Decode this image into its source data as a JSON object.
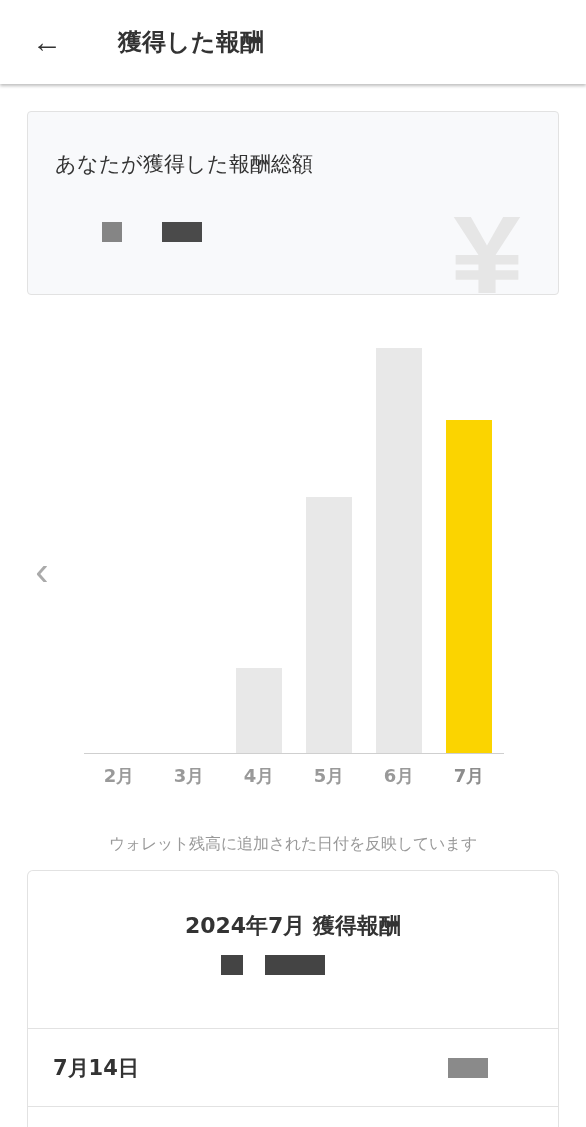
{
  "header": {
    "back": "←",
    "title": "獲得した報酬"
  },
  "total_card": {
    "label": "あなたが獲得した報酬総額"
  },
  "chart": {
    "back": "‹",
    "months": [
      {
        "label": "2月",
        "selected": false
      },
      {
        "label": "3月",
        "selected": false
      },
      {
        "label": "4月",
        "selected": false
      },
      {
        "label": "5月",
        "selected": false
      },
      {
        "label": "6月",
        "selected": false
      },
      {
        "label": "7月",
        "selected": true
      }
    ]
  },
  "note": "ウォレット残高に追加された日付を反映しています",
  "month_card": {
    "title": "2024年7月 獲得報酬",
    "rows": [
      {
        "date": "7月14日"
      }
    ]
  }
}
